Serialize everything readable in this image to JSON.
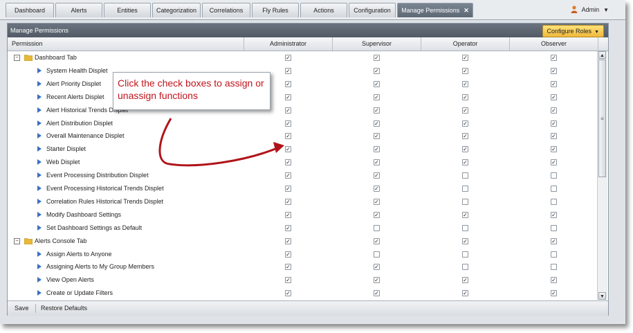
{
  "tabs": [
    {
      "label": "Dashboard"
    },
    {
      "label": "Alerts"
    },
    {
      "label": "Entities"
    },
    {
      "label": "Categorization"
    },
    {
      "label": "Correlations"
    },
    {
      "label": "Fly Rules"
    },
    {
      "label": "Actions"
    },
    {
      "label": "Configuration"
    },
    {
      "label": "Manage Permissions",
      "active": true,
      "close_icon": "close-icon"
    }
  ],
  "user": {
    "name": "Admin",
    "icon": "user-icon"
  },
  "panel": {
    "title": "Manage Permissions",
    "configure_roles_label": "Configure Roles"
  },
  "columns": {
    "permission": "Permission",
    "administrator": "Administrator",
    "supervisor": "Supervisor",
    "operator": "Operator",
    "observer": "Observer"
  },
  "rows": [
    {
      "label": "Dashboard Tab",
      "group": true,
      "values": [
        true,
        true,
        true,
        true
      ]
    },
    {
      "label": "System Health Displet",
      "values": [
        true,
        true,
        true,
        true
      ]
    },
    {
      "label": "Alert Priority Displet",
      "values": [
        true,
        true,
        true,
        true
      ]
    },
    {
      "label": "Recent Alerts Displet",
      "values": [
        true,
        true,
        true,
        true
      ]
    },
    {
      "label": "Alert Historical Trends Displet",
      "values": [
        true,
        true,
        true,
        true
      ]
    },
    {
      "label": "Alert Distribution Displet",
      "values": [
        true,
        true,
        true,
        true
      ]
    },
    {
      "label": "Overall Maintenance Displet",
      "values": [
        true,
        true,
        true,
        true
      ]
    },
    {
      "label": "Starter Displet",
      "values": [
        true,
        true,
        true,
        true
      ]
    },
    {
      "label": "Web Displet",
      "values": [
        true,
        true,
        true,
        true
      ]
    },
    {
      "label": "Event Processing Distribution Displet",
      "values": [
        true,
        true,
        false,
        false
      ]
    },
    {
      "label": "Event Processing Historical Trends Displet",
      "values": [
        true,
        true,
        false,
        false
      ]
    },
    {
      "label": "Correlation Rules Historical Trends Displet",
      "values": [
        true,
        true,
        false,
        false
      ]
    },
    {
      "label": "Modify Dashboard Settings",
      "values": [
        true,
        true,
        true,
        true
      ]
    },
    {
      "label": "Set Dashboard Settings as Default",
      "values": [
        true,
        false,
        false,
        false
      ]
    },
    {
      "label": "Alerts Console Tab",
      "group": true,
      "values": [
        true,
        true,
        true,
        true
      ]
    },
    {
      "label": "Assign Alerts to Anyone",
      "values": [
        true,
        false,
        false,
        false
      ]
    },
    {
      "label": "Assigning Alerts to My Group Members",
      "values": [
        true,
        true,
        false,
        false
      ]
    },
    {
      "label": "View Open Alerts",
      "values": [
        true,
        true,
        true,
        true
      ]
    },
    {
      "label": "Create or Update Filters",
      "values": [
        true,
        true,
        true,
        true
      ]
    }
  ],
  "footer": {
    "save_label": "Save",
    "restore_label": "Restore Defaults"
  },
  "callout": {
    "text": "Click the check boxes to assign or unassign functions",
    "color": "#c0141b"
  },
  "colors": {
    "accent_button": "#f0b83a",
    "header_bar": "#5d6874",
    "tree_arrow": "#3b6fc4",
    "folder": "#e8b838"
  }
}
